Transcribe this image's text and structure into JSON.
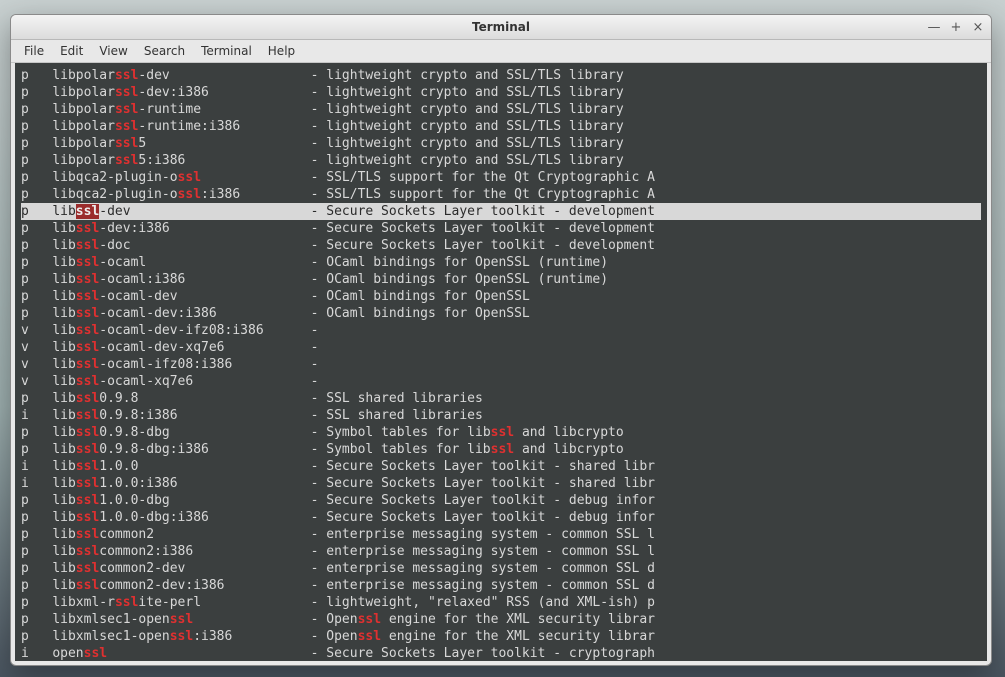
{
  "window": {
    "title": "Terminal"
  },
  "menubar": [
    "File",
    "Edit",
    "View",
    "Search",
    "Terminal",
    "Help"
  ],
  "win_buttons": {
    "min": "—",
    "max": "+",
    "close": "×"
  },
  "highlight_token": "ssl",
  "selected_index": 8,
  "name_col_chars": 37,
  "rows": [
    {
      "flag": "p",
      "name": "libpolar{ssl}-dev",
      "desc": "lightweight crypto and SSL/TLS library"
    },
    {
      "flag": "p",
      "name": "libpolar{ssl}-dev:i386",
      "desc": "lightweight crypto and SSL/TLS library"
    },
    {
      "flag": "p",
      "name": "libpolar{ssl}-runtime",
      "desc": "lightweight crypto and SSL/TLS library"
    },
    {
      "flag": "p",
      "name": "libpolar{ssl}-runtime:i386",
      "desc": "lightweight crypto and SSL/TLS library"
    },
    {
      "flag": "p",
      "name": "libpolar{ssl}5",
      "desc": "lightweight crypto and SSL/TLS library"
    },
    {
      "flag": "p",
      "name": "libpolar{ssl}5:i386",
      "desc": "lightweight crypto and SSL/TLS library"
    },
    {
      "flag": "p",
      "name": "libqca2-plugin-o{ssl}",
      "desc": "SSL/TLS support for the Qt Cryptographic A"
    },
    {
      "flag": "p",
      "name": "libqca2-plugin-o{ssl}:i386",
      "desc": "SSL/TLS support for the Qt Cryptographic A"
    },
    {
      "flag": "p",
      "name": "lib{ssl}-dev",
      "desc": "Secure Sockets Layer toolkit - development"
    },
    {
      "flag": "p",
      "name": "lib{ssl}-dev:i386",
      "desc": "Secure Sockets Layer toolkit - development"
    },
    {
      "flag": "p",
      "name": "lib{ssl}-doc",
      "desc": "Secure Sockets Layer toolkit - development"
    },
    {
      "flag": "p",
      "name": "lib{ssl}-ocaml",
      "desc": "OCaml bindings for OpenSSL (runtime)"
    },
    {
      "flag": "p",
      "name": "lib{ssl}-ocaml:i386",
      "desc": "OCaml bindings for OpenSSL (runtime)"
    },
    {
      "flag": "p",
      "name": "lib{ssl}-ocaml-dev",
      "desc": "OCaml bindings for OpenSSL"
    },
    {
      "flag": "p",
      "name": "lib{ssl}-ocaml-dev:i386",
      "desc": "OCaml bindings for OpenSSL"
    },
    {
      "flag": "v",
      "name": "lib{ssl}-ocaml-dev-ifz08:i386",
      "desc": ""
    },
    {
      "flag": "v",
      "name": "lib{ssl}-ocaml-dev-xq7e6",
      "desc": ""
    },
    {
      "flag": "v",
      "name": "lib{ssl}-ocaml-ifz08:i386",
      "desc": ""
    },
    {
      "flag": "v",
      "name": "lib{ssl}-ocaml-xq7e6",
      "desc": ""
    },
    {
      "flag": "p",
      "name": "lib{ssl}0.9.8",
      "desc": "SSL shared libraries"
    },
    {
      "flag": "i",
      "name": "lib{ssl}0.9.8:i386",
      "desc": "SSL shared libraries"
    },
    {
      "flag": "p",
      "name": "lib{ssl}0.9.8-dbg",
      "desc": "Symbol tables for lib{ssl} and libcrypto"
    },
    {
      "flag": "p",
      "name": "lib{ssl}0.9.8-dbg:i386",
      "desc": "Symbol tables for lib{ssl} and libcrypto"
    },
    {
      "flag": "i",
      "name": "lib{ssl}1.0.0",
      "desc": "Secure Sockets Layer toolkit - shared libr"
    },
    {
      "flag": "i",
      "name": "lib{ssl}1.0.0:i386",
      "desc": "Secure Sockets Layer toolkit - shared libr"
    },
    {
      "flag": "p",
      "name": "lib{ssl}1.0.0-dbg",
      "desc": "Secure Sockets Layer toolkit - debug infor"
    },
    {
      "flag": "p",
      "name": "lib{ssl}1.0.0-dbg:i386",
      "desc": "Secure Sockets Layer toolkit - debug infor"
    },
    {
      "flag": "p",
      "name": "lib{ssl}common2",
      "desc": "enterprise messaging system - common SSL l"
    },
    {
      "flag": "p",
      "name": "lib{ssl}common2:i386",
      "desc": "enterprise messaging system - common SSL l"
    },
    {
      "flag": "p",
      "name": "lib{ssl}common2-dev",
      "desc": "enterprise messaging system - common SSL d"
    },
    {
      "flag": "p",
      "name": "lib{ssl}common2-dev:i386",
      "desc": "enterprise messaging system - common SSL d"
    },
    {
      "flag": "p",
      "name": "libxml-r{ssl}ite-perl",
      "desc": "lightweight, \"relaxed\" RSS (and XML-ish) p"
    },
    {
      "flag": "p",
      "name": "libxmlsec1-open{ssl}",
      "desc": "Open{ssl} engine for the XML security librar"
    },
    {
      "flag": "p",
      "name": "libxmlsec1-open{ssl}:i386",
      "desc": "Open{ssl} engine for the XML security librar"
    },
    {
      "flag": "i",
      "name": "open{ssl}",
      "desc": "Secure Sockets Layer toolkit - cryptograph"
    }
  ]
}
